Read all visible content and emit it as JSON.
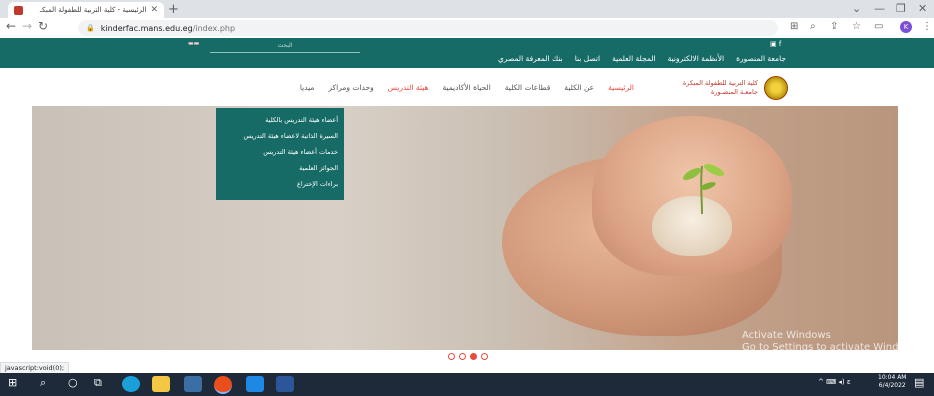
{
  "browser": {
    "tab_title": "الرئيسية - كلية التربية للطفولة المبكـ",
    "url_host": "kinderfac.mans.edu.eg",
    "url_path": "/index.php",
    "profile_initial": "K",
    "status_text": "javascript:void(0);"
  },
  "site": {
    "search_placeholder": "البحث",
    "top_links": [
      "جامعة المنصورة",
      "الأنظمة الالكترونية",
      "المجلة العلمية",
      "اتصل بنا",
      "بنك المعرفة المصري"
    ],
    "logo_title": "كلية التربية للطفولة المبكرة",
    "logo_subtitle": "جامعـة المنصـورة",
    "nav": [
      "الرئيسية",
      "عن الكلية",
      "قطاعات الكلية",
      "الحياة الأكاديمية",
      "هيئة التدريس",
      "وحدات ومراكز",
      "ميديا"
    ],
    "dropdown": [
      "أعضاء هيئة التدريس بالكلية",
      "السيرة الذاتية لاعضاء هيئة التدريس",
      "خدمات أعضاء هيئة التدريس",
      "الجوائز العلمية",
      "براءات الإختراع"
    ]
  },
  "watermark": {
    "line1": "Activate Windows",
    "line2": "Go to Settings to activate Windows."
  },
  "taskbar": {
    "time": "10:04 AM",
    "date": "6/4/2022",
    "lang": "ε"
  }
}
